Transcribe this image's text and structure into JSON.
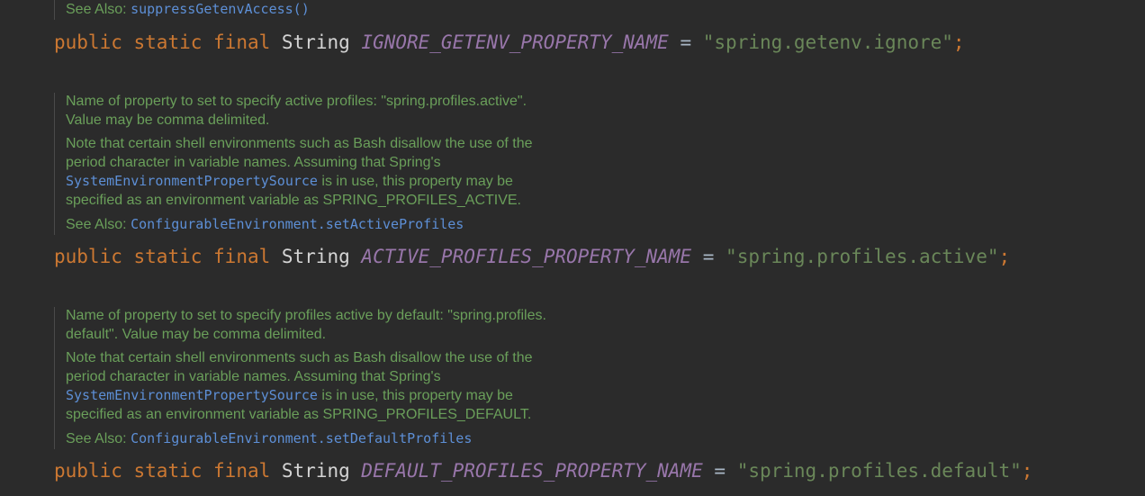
{
  "block0": {
    "see_also_label": "See Also:",
    "see_also_link": "suppressGetenvAccess()",
    "decl": {
      "kw_public": "public",
      "kw_static": "static",
      "kw_final": "final",
      "type": "String",
      "name": "IGNORE_GETENV_PROPERTY_NAME",
      "eq": "=",
      "value": "\"spring.getenv.ignore\"",
      "semi": ";"
    }
  },
  "block1": {
    "desc_line1": "Name of property to set to specify active profiles: \"spring.profiles.active\".",
    "desc_line2": "Value may be comma delimited.",
    "note_line1": "Note that certain shell environments such as Bash disallow the use of the",
    "note_line2": "period character in variable names. Assuming that Spring's",
    "note_code": "SystemEnvironmentPropertySource",
    "note_line3_rest": " is in use, this property may be",
    "note_line4": "specified as an environment variable as SPRING_PROFILES_ACTIVE.",
    "see_also_label": "See Also:",
    "see_also_link": "ConfigurableEnvironment.setActiveProfiles",
    "decl": {
      "kw_public": "public",
      "kw_static": "static",
      "kw_final": "final",
      "type": "String",
      "name": "ACTIVE_PROFILES_PROPERTY_NAME",
      "eq": "=",
      "value": "\"spring.profiles.active\"",
      "semi": ";"
    }
  },
  "block2": {
    "desc_line1": "Name of property to set to specify profiles active by default: \"spring.profiles.",
    "desc_line2": "default\". Value may be comma delimited.",
    "note_line1": "Note that certain shell environments such as Bash disallow the use of the",
    "note_line2": "period character in variable names. Assuming that Spring's",
    "note_code": "SystemEnvironmentPropertySource",
    "note_line3_rest": " is in use, this property may be",
    "note_line4": "specified as an environment variable as SPRING_PROFILES_DEFAULT.",
    "see_also_label": "See Also:",
    "see_also_link": "ConfigurableEnvironment.setDefaultProfiles",
    "decl": {
      "kw_public": "public",
      "kw_static": "static",
      "kw_final": "final",
      "type": "String",
      "name": "DEFAULT_PROFILES_PROPERTY_NAME",
      "eq": "=",
      "value": "\"spring.profiles.default\"",
      "semi": ";"
    }
  },
  "colors": {
    "background": "#2b2b2b",
    "doc_text": "#6a9f5a",
    "link": "#5d8fd6",
    "keyword": "#cc7832",
    "constant": "#9876aa",
    "string": "#6a8759"
  }
}
